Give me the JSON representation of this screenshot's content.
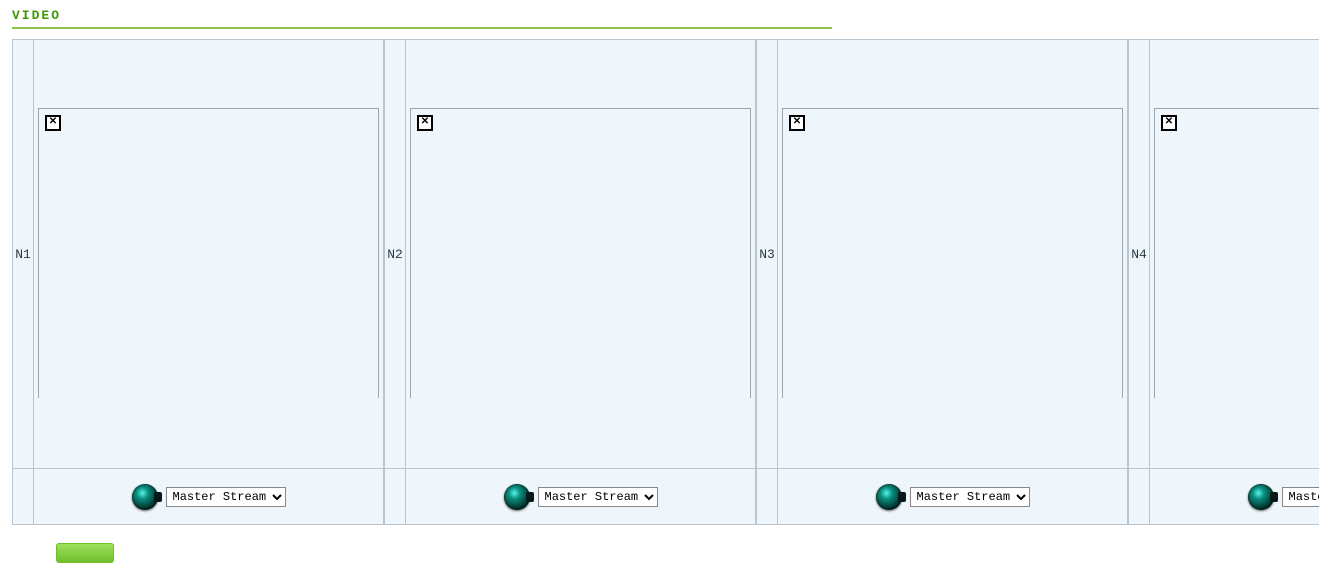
{
  "section": {
    "title": "VIDEO"
  },
  "channels": [
    {
      "label": "N1",
      "stream": "Master Stream"
    },
    {
      "label": "N2",
      "stream": "Master Stream"
    },
    {
      "label": "N3",
      "stream": "Master Stream"
    },
    {
      "label": "N4",
      "stream": "Master Stream"
    }
  ],
  "stream_options": [
    "Master Stream"
  ]
}
